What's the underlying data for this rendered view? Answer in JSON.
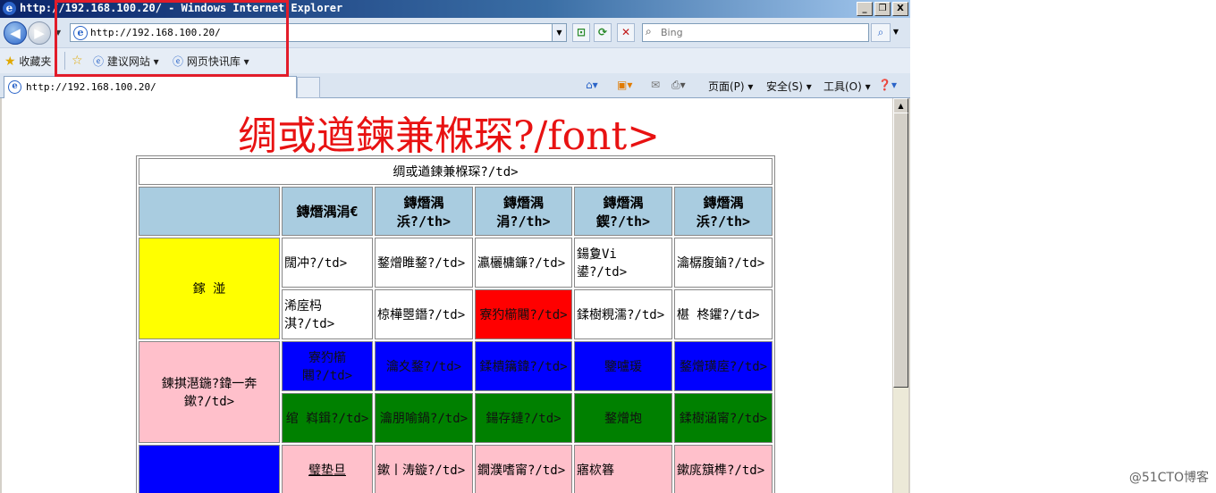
{
  "window": {
    "title": "http://192.168.100.20/ - Windows Internet Explorer",
    "app_icon": "ie-icon",
    "minimize": "_",
    "maximize": "❐",
    "close": "X"
  },
  "nav": {
    "back": "◀",
    "forward": "▶",
    "address": "http://192.168.100.20/",
    "search_placeholder": "Bing"
  },
  "favorites_bar": {
    "favorites_label": "收藏夹",
    "items": [
      {
        "label": "建议网站 ▾",
        "icon": "ie-page-icon"
      },
      {
        "label": "网页快讯库 ▾",
        "icon": "ie-page-icon"
      }
    ]
  },
  "tab": {
    "title": "http://192.168.100.20/"
  },
  "command_bar": {
    "page": "页面(P) ▾",
    "safety": "安全(S) ▾",
    "tools": "工具(O) ▾"
  },
  "page": {
    "heading": "绸或遒鍊兼椺琛?/font>",
    "caption": "绸或遒鍊兼椺琛?/td>",
    "headers": [
      "",
      "鏄熸湡涓€",
      "鏄熸湡浜?/th>",
      "鏄熸湡涓?/th>",
      "鏄熸湡鍥?/th>",
      "鏄熸湡浜?/th>"
    ],
    "rows": [
      {
        "group": "鎵  湴",
        "group_bg": "#ffff00",
        "cells": [
          [
            {
              "text": "闊冲?/td>",
              "bg": "#ffffff"
            },
            {
              "text": "鍪熷睢鍪?/td>",
              "bg": "#ffffff"
            },
            {
              "text": "瀛欐槦鐮?/td>",
              "bg": "#ffffff"
            },
            {
              "text": "鍚夐Vi 鍙?/td>",
              "bg": "#ffffff"
            },
            {
              "text": "瀹樼腹鏀?/td>",
              "bg": "#ffffff"
            }
          ],
          [
            {
              "text": "浠庢杩淇?/td>",
              "bg": "#ffffff"
            },
            {
              "text": "椋樺瞾鐕?/td>",
              "bg": "#ffffff"
            },
            {
              "text": "寮犳櫤闀?/td>",
              "bg": "#ff0000"
            },
            {
              "text": "鍒樹粯濡?/td>",
              "bg": "#ffffff"
            },
            {
              "text": "椹  柊鑺?/td>",
              "bg": "#ffffff"
            }
          ]
        ]
      },
      {
        "group": "鍊掑潖鍦?鍏一奔鏉?/td>",
        "group_bg": "#ffc0cb",
        "cells": [
          [
            {
              "text": "寮犳櫤闀?/td>",
              "bg": "#0000ff"
            },
            {
              "text": "瀹夊鍪?/td>",
              "bg": "#0000ff"
            },
            {
              "text": "鍒樻簼鍏?/td>",
              "bg": "#0000ff"
            },
            {
              "text": "鑒嚧瑗",
              "bg": "#0000ff"
            },
            {
              "text": "鍪熷璜庢?/td>",
              "bg": "#0000ff"
            }
          ],
          [
            {
              "text": "绾  嵙鍓?/td>",
              "bg": "#008000"
            },
            {
              "text": "瀹朋喻鍋?/td>",
              "bg": "#008000"
            },
            {
              "text": "鍚存鏈?/td>",
              "bg": "#008000"
            },
            {
              "text": "鍪熷垉",
              "bg": "#008000"
            },
            {
              "text": "鍒樹涵甯?/td>",
              "bg": "#008000"
            }
          ]
        ]
      },
      {
        "group": "",
        "group_bg": "#0000ff",
        "cells": [
          [
            {
              "text": "璧垫旦",
              "bg": "#ffc0cb",
              "underline": true
            },
            {
              "text": "鏉丨涛鏇?/td>",
              "bg": "#ffc0cb"
            },
            {
              "text": "鐗濮嗜甯?/td>",
              "bg": "#ffc0cb"
            },
            {
              "text": "寤栨簭",
              "bg": "#ffc0cb"
            },
            {
              "text": "鏉庣簱榫?/td>",
              "bg": "#ffc0cb"
            }
          ]
        ]
      }
    ]
  },
  "watermark": "@51CTO博客",
  "annotation_color": "#e21c2a"
}
